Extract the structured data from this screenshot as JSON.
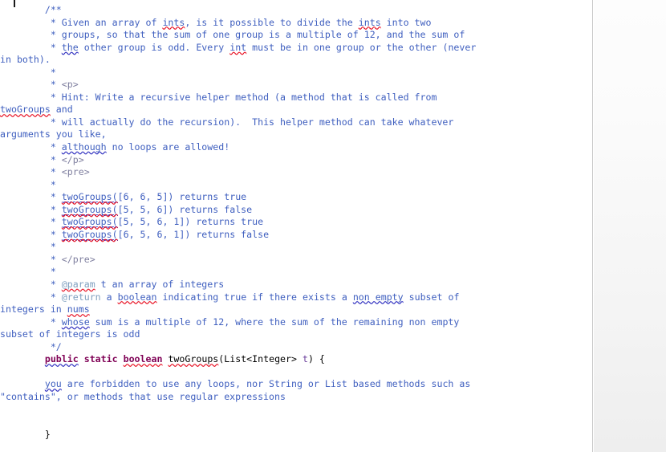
{
  "editor": {
    "language": "java",
    "caret_visible": true,
    "colors": {
      "background": "#ffffff",
      "comment": "#3f5fbf",
      "javadoc_tag": "#7f9fbf",
      "html_tag": "#7f7f9f",
      "keyword": "#7f0055",
      "parameter": "#6a3e9b",
      "plain_text": "#000000",
      "spell_error_underline": "#e81123",
      "grammar_warning_underline": "#3030c0",
      "panel_divider": "#c9c9c9",
      "side_panel": "#eeeeee"
    },
    "lines": [
      {
        "id": "l01",
        "indent": "        ",
        "segments": [
          {
            "t": "/**",
            "c": "cmt"
          }
        ]
      },
      {
        "id": "l02",
        "indent": "         ",
        "segments": [
          {
            "t": "* Given an array of ",
            "c": "cmt"
          },
          {
            "t": "ints",
            "c": "cmt",
            "sq": "red"
          },
          {
            "t": ", is it possible to divide the ",
            "c": "cmt"
          },
          {
            "t": "ints",
            "c": "cmt",
            "sq": "red"
          },
          {
            "t": " into two",
            "c": "cmt"
          }
        ]
      },
      {
        "id": "l03",
        "indent": "         ",
        "segments": [
          {
            "t": "* groups, so that the sum of one group is a multiple of 12, and the sum of",
            "c": "cmt"
          }
        ]
      },
      {
        "id": "l04",
        "indent": "         ",
        "segments": [
          {
            "t": "* ",
            "c": "cmt"
          },
          {
            "t": "the",
            "c": "cmt",
            "sq": "blue"
          },
          {
            "t": " other group is odd. Every ",
            "c": "cmt"
          },
          {
            "t": "int",
            "c": "cmt",
            "sq": "red"
          },
          {
            "t": " must be in one group or the other (never",
            "c": "cmt"
          }
        ]
      },
      {
        "id": "l05",
        "indent": "",
        "wrapped": true,
        "segments": [
          {
            "t": "in both).",
            "c": "cmt"
          }
        ]
      },
      {
        "id": "l06",
        "indent": "         ",
        "segments": [
          {
            "t": "*",
            "c": "cmt"
          }
        ]
      },
      {
        "id": "l07",
        "indent": "         ",
        "segments": [
          {
            "t": "* ",
            "c": "cmt"
          },
          {
            "t": "<p>",
            "c": "tag"
          }
        ]
      },
      {
        "id": "l08",
        "indent": "         ",
        "segments": [
          {
            "t": "* Hint: Write a recursive helper method (a method that is called from",
            "c": "cmt"
          }
        ]
      },
      {
        "id": "l09",
        "indent": "",
        "wrapped": true,
        "segments": [
          {
            "t": "twoGroups",
            "c": "cmt",
            "sq": "red"
          },
          {
            "t": " and",
            "c": "cmt"
          }
        ]
      },
      {
        "id": "l10",
        "indent": "         ",
        "segments": [
          {
            "t": "* will actually do the recursion).  This helper method can take whatever",
            "c": "cmt"
          }
        ]
      },
      {
        "id": "l11",
        "indent": "",
        "wrapped": true,
        "segments": [
          {
            "t": "arguments you like,",
            "c": "cmt"
          }
        ]
      },
      {
        "id": "l12",
        "indent": "         ",
        "segments": [
          {
            "t": "* ",
            "c": "cmt"
          },
          {
            "t": "although",
            "c": "cmt",
            "sq": "blue"
          },
          {
            "t": " no loops are allowed!",
            "c": "cmt"
          }
        ]
      },
      {
        "id": "l13",
        "indent": "         ",
        "segments": [
          {
            "t": "* ",
            "c": "cmt"
          },
          {
            "t": "</p>",
            "c": "tag"
          }
        ]
      },
      {
        "id": "l14",
        "indent": "         ",
        "segments": [
          {
            "t": "* ",
            "c": "cmt"
          },
          {
            "t": "<pre>",
            "c": "tag"
          }
        ]
      },
      {
        "id": "l15",
        "indent": "         ",
        "segments": [
          {
            "t": "*",
            "c": "cmt"
          }
        ]
      },
      {
        "id": "l16",
        "indent": "         ",
        "segments": [
          {
            "t": "* ",
            "c": "cmt"
          },
          {
            "t": "twoGroups(",
            "c": "cmt",
            "sq": "both"
          },
          {
            "t": "[6, 6, 5]) returns true",
            "c": "cmt"
          }
        ]
      },
      {
        "id": "l17",
        "indent": "         ",
        "segments": [
          {
            "t": "* ",
            "c": "cmt"
          },
          {
            "t": "twoGroups(",
            "c": "cmt",
            "sq": "both"
          },
          {
            "t": "[5, 5, 6]) returns false",
            "c": "cmt"
          }
        ]
      },
      {
        "id": "l18",
        "indent": "         ",
        "segments": [
          {
            "t": "* ",
            "c": "cmt"
          },
          {
            "t": "twoGroups(",
            "c": "cmt",
            "sq": "both"
          },
          {
            "t": "[5, 5, 6, 1]) returns true",
            "c": "cmt"
          }
        ]
      },
      {
        "id": "l19",
        "indent": "         ",
        "segments": [
          {
            "t": "* ",
            "c": "cmt"
          },
          {
            "t": "twoGroups(",
            "c": "cmt",
            "sq": "both"
          },
          {
            "t": "[6, 5, 6, 1]) returns false",
            "c": "cmt"
          }
        ]
      },
      {
        "id": "l20",
        "indent": "         ",
        "segments": [
          {
            "t": "*",
            "c": "cmt"
          }
        ]
      },
      {
        "id": "l21",
        "indent": "         ",
        "segments": [
          {
            "t": "* ",
            "c": "cmt"
          },
          {
            "t": "</pre>",
            "c": "tag"
          }
        ]
      },
      {
        "id": "l22",
        "indent": "         ",
        "segments": [
          {
            "t": "*",
            "c": "cmt"
          }
        ]
      },
      {
        "id": "l23",
        "indent": "         ",
        "segments": [
          {
            "t": "* ",
            "c": "cmt"
          },
          {
            "t": "@param",
            "c": "jdoc-kw",
            "sq": "red"
          },
          {
            "t": " t an array of integers",
            "c": "cmt"
          }
        ]
      },
      {
        "id": "l24",
        "indent": "         ",
        "segments": [
          {
            "t": "* ",
            "c": "cmt"
          },
          {
            "t": "@return",
            "c": "jdoc-kw"
          },
          {
            "t": " a ",
            "c": "cmt"
          },
          {
            "t": "boolean",
            "c": "cmt",
            "sq": "red"
          },
          {
            "t": " indicating true if there exists a ",
            "c": "cmt"
          },
          {
            "t": "non empty",
            "c": "cmt",
            "sq": "blue"
          },
          {
            "t": " subset of",
            "c": "cmt"
          }
        ]
      },
      {
        "id": "l25",
        "indent": "",
        "wrapped": true,
        "segments": [
          {
            "t": "integers in ",
            "c": "cmt"
          },
          {
            "t": "nums",
            "c": "cmt",
            "sq": "red"
          }
        ]
      },
      {
        "id": "l26",
        "indent": "         ",
        "segments": [
          {
            "t": "* ",
            "c": "cmt"
          },
          {
            "t": "whose",
            "c": "cmt",
            "sq": "blue"
          },
          {
            "t": " sum is a multiple of 12, where the sum of the remaining non empty",
            "c": "cmt"
          }
        ]
      },
      {
        "id": "l27",
        "indent": "",
        "wrapped": true,
        "segments": [
          {
            "t": "subset of integers is odd",
            "c": "cmt"
          }
        ]
      },
      {
        "id": "l28",
        "indent": "         ",
        "segments": [
          {
            "t": "*/",
            "c": "cmt"
          }
        ]
      },
      {
        "id": "l29",
        "indent": "        ",
        "segments": [
          {
            "t": "public",
            "c": "kw",
            "sq": "blue"
          },
          {
            "t": " ",
            "c": "plain"
          },
          {
            "t": "static",
            "c": "kw"
          },
          {
            "t": " ",
            "c": "plain"
          },
          {
            "t": "boolean",
            "c": "kw",
            "sq": "red"
          },
          {
            "t": " ",
            "c": "plain"
          },
          {
            "t": "twoGroups",
            "c": "ident",
            "sq": "red"
          },
          {
            "t": "(List<Integer> ",
            "c": "plain"
          },
          {
            "t": "t",
            "c": "prm"
          },
          {
            "t": ") {",
            "c": "plain"
          }
        ]
      },
      {
        "id": "l30",
        "indent": "",
        "segments": []
      },
      {
        "id": "l31",
        "indent": "        ",
        "segments": [
          {
            "t": "you",
            "c": "cmt",
            "sq": "blue"
          },
          {
            "t": " are forbidden to use any loops, nor String or List based methods such as",
            "c": "cmt"
          }
        ]
      },
      {
        "id": "l32",
        "indent": "",
        "wrapped": true,
        "segments": [
          {
            "t": "\"contains\", or methods that use regular expressions",
            "c": "cmt"
          }
        ]
      },
      {
        "id": "l33",
        "indent": "",
        "segments": []
      },
      {
        "id": "l34",
        "indent": "",
        "segments": []
      },
      {
        "id": "l35",
        "indent": "        ",
        "segments": [
          {
            "t": "}",
            "c": "plain"
          }
        ]
      }
    ]
  }
}
